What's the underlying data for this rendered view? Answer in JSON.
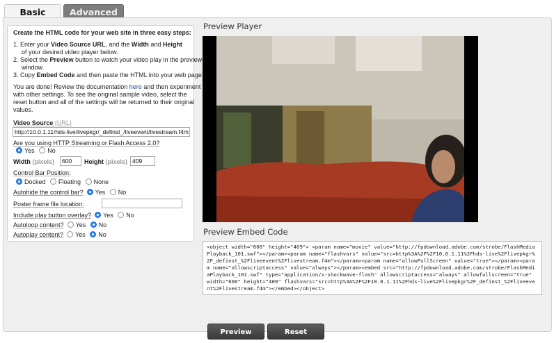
{
  "tabs": [
    {
      "label": "Basic",
      "active": true
    },
    {
      "label": "Advanced",
      "active": false
    }
  ],
  "form": {
    "heading": "Create the HTML code for your web site in three easy steps:",
    "step1": {
      "pre": "1.  Enter your ",
      "b1": "Video Source URL",
      "mid": ", and the ",
      "b2": "Width",
      "and": " and ",
      "b3": "Height",
      "line2": "of your desired video player below."
    },
    "step2": {
      "pre": "2.  Select the ",
      "b1": "Preview",
      "post": " button to watch your video play in the preview",
      "line2": "window."
    },
    "step3": {
      "pre": "3.  Copy ",
      "b1": "Embed Code",
      "post": " and then paste the HTML into your web page."
    },
    "done": {
      "pre": "You are done! Review the documentation ",
      "link": "here",
      "post": " and then experiment",
      "line2": "with other settings. To see the original sample video, select the",
      "line3": "reset button and all of the settings will be returned to their original",
      "line4": "values."
    },
    "video_source": {
      "label": "Video Source",
      "hint": "(URL)",
      "value": "http://10.0.1.11/hds-live/livepkgr/_definst_/liveevent/livestream.f4m"
    },
    "streaming": {
      "question": "Are you using HTTP Streaming or Flash Access 2.0?",
      "yes": "Yes",
      "no": "No",
      "selected": "Yes"
    },
    "width": {
      "label": "Width",
      "hint": "(pixels)",
      "value": "600"
    },
    "height": {
      "label": "Height",
      "hint": "(pixels)",
      "value": "409"
    },
    "control_bar": {
      "label": "Control Bar Position:",
      "docked": "Docked",
      "floating": "Floating",
      "none": "None",
      "selected": "Docked"
    },
    "autohide": {
      "question": "Autohide the control bar?",
      "yes": "Yes",
      "no": "No",
      "selected": "Yes"
    },
    "poster": {
      "label": "Poster frame file location:",
      "value": ""
    },
    "play_overlay": {
      "question": "Include play button overlay?",
      "yes": "Yes",
      "no": "No",
      "selected": "Yes"
    },
    "autoloop": {
      "question": "Autoloop content?",
      "yes": "Yes",
      "no": "No",
      "selected": "No"
    },
    "autoplay": {
      "question": "Autoplay content?",
      "yes": "Yes",
      "no": "No",
      "selected": "No"
    }
  },
  "preview": {
    "title": "Preview Player"
  },
  "embed": {
    "title": "Preview Embed Code",
    "code": "<object width=\"600\" height=\"409\"> <param name=\"movie\" value=\"http://fpdownload.adobe.com/strobe/FlashMediaPlayback_101.swf\"></param><param name=\"flashvars\" value=\"src=http%3A%2F%2F10.0.1.11%2Fhds-live%2Flivepkgr%2F_definst_%2Fliveevent%2Flivestream.f4m\"></param><param name=\"allowFullScreen\" value=\"true\"></param><param name=\"allowscriptaccess\" value=\"always\"></param><embed src=\"http://fpdownload.adobe.com/strobe/FlashMediaPlayback_101.swf\" type=\"application/x-shockwave-flash\" allowscriptaccess=\"always\" allowfullscreen=\"true\" width=\"600\" height=\"409\" flashvars=\"src=http%3A%2F%2F10.0.1.11%2Fhds-live%2Flivepkgr%2F_definst_%2Fliveevent%2Flivestream.f4m\"></embed></object>"
  },
  "buttons": {
    "preview": "Preview",
    "reset": "Reset"
  },
  "colors": {
    "tab_active_bg": "#f4f4f4",
    "tab_inactive_bg": "#7d7d7d",
    "panel_bg": "#efefef",
    "button_bg": "#4a4a4a",
    "radio_selected": "#2b82ec",
    "link": "#1a4c96"
  }
}
